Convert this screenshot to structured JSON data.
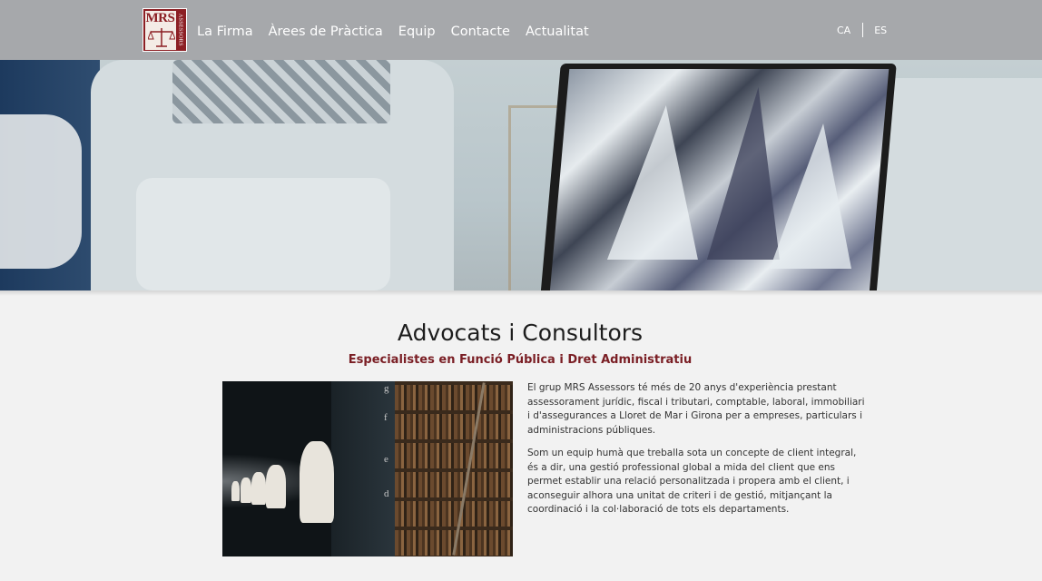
{
  "header": {
    "logo": {
      "text_main": "MRS",
      "text_side": "ASSESSORS"
    },
    "nav": [
      "La Firma",
      "Àrees de Pràctica",
      "Equip",
      "Contacte",
      "Actualitat"
    ],
    "languages": [
      "CA",
      "ES"
    ]
  },
  "slider": {
    "slide_count": 5,
    "active_slide": 3
  },
  "main": {
    "title": "Advocats i Consultors",
    "subtitle": "Especialistes en Funció Pública i Dret Administratiu",
    "photo_letters": [
      "g",
      "f",
      "e",
      "d"
    ],
    "paragraphs": [
      "El grup MRS Assessors té més de 20 anys d'experiència prestant assessorament jurídic, fiscal i tributari, comptable, laboral, immobiliari i d'assegurances a Lloret de Mar i Girona per a empreses, particulars i administracions públiques.",
      "Som un equip humà que treballa sota un concepte de client integral, és a dir, una gestió professional global a mida del client que ens permet establir una relació personalitzada i propera amb el client, i aconseguir alhora una unitat de criteri i de gestió, mitjançant la coordinació i la col·laboració de tots els departaments."
    ]
  },
  "colors": {
    "header_bg": "#a6a8ab",
    "brand": "#7a1e24",
    "page_bg": "#f2f2f2"
  }
}
